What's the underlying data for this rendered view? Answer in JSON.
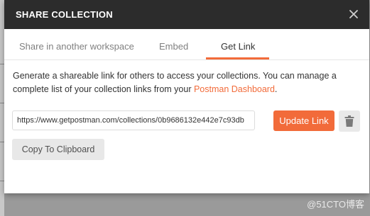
{
  "dialog": {
    "title": "SHARE COLLECTION",
    "close_icon": "close-icon"
  },
  "tabs": [
    {
      "label": "Share in another workspace",
      "active": false
    },
    {
      "label": "Embed",
      "active": false
    },
    {
      "label": "Get Link",
      "active": true
    }
  ],
  "body": {
    "description_text": "Generate a shareable link for others to access your collections. You can manage a complete list of your collection links from your ",
    "dashboard_link": "Postman Dashboard",
    "description_end": ".",
    "link_value": "https://www.getpostman.com/collections/0b9686132e442e7c93db",
    "update_button": "Update Link",
    "delete_icon": "trash-icon",
    "copy_button": "Copy To Clipboard"
  },
  "watermark": "@51CTO博客",
  "colors": {
    "accent": "#f26b3a",
    "header_bg": "#2c2c2c"
  }
}
